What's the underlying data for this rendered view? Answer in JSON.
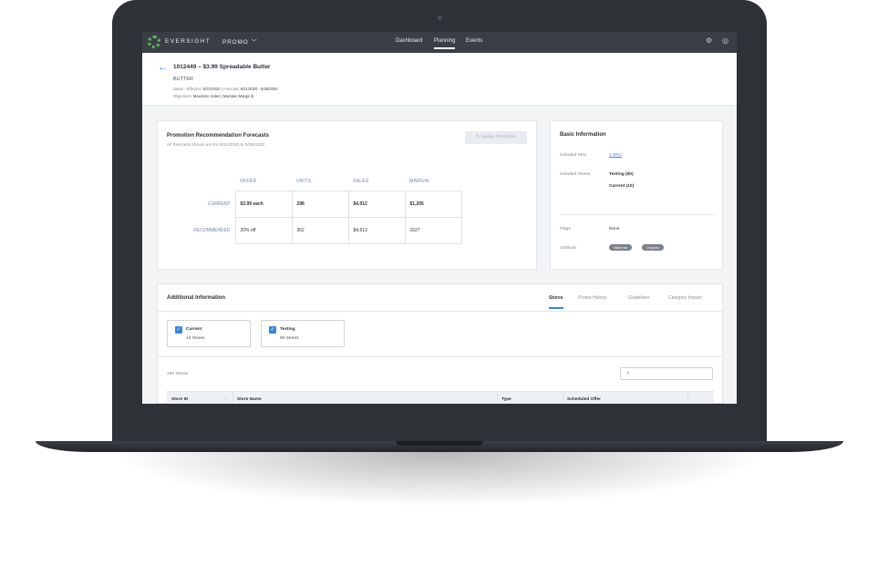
{
  "nav": {
    "brand": "EVERSIGHT",
    "promo_menu": "PROMO",
    "links": [
      "Dashboard",
      "Planning",
      "Events"
    ],
    "active_link": "Planning",
    "icons": [
      "gear-icon",
      "user-icon"
    ]
  },
  "header": {
    "title": "1012449 – $3.99 Spreadable Butter",
    "category": "BUTTER",
    "dates_label": "Dates - Effective:",
    "effective_date": "5/21/2020",
    "forecast_label": "Forecast:",
    "forecast_range": "5/21/2020 - 5/28/2020",
    "objectives_label": "Objectives:",
    "objectives": "Maximize Sales | Maintain Margin $"
  },
  "forecasts": {
    "title": "Promotion Recommendation Forecasts",
    "subtitle": "All forecasts shown are for 5/21/2020 to 5/28/2020",
    "update_button": "Update Promotion",
    "columns": [
      "OFFER",
      "UNITS",
      "SALES",
      "MARGIN"
    ],
    "rows": [
      {
        "label": "CURRENT",
        "values": [
          "$3.99 each",
          "298",
          "$4,012",
          "$1,205"
        ]
      },
      {
        "label": "RECOMMENDED",
        "values": [
          "20% off",
          "352",
          "$4,613",
          "1627"
        ]
      }
    ]
  },
  "basic_info": {
    "title": "Basic Information",
    "included_sku_label": "Included SKU",
    "included_sku_value": "1 SKU",
    "included_stores_label": "Included Stores",
    "stores_testing": "Testing (90)",
    "stores_current": "Current (10)",
    "flags_label": "Flags",
    "flags_value": "None",
    "attribute_label": "Attribute",
    "attributes": [
      "National",
      "Organic"
    ]
  },
  "additional": {
    "title": "Additional Information",
    "tabs": [
      "Stores",
      "Promo History",
      "Guidelines",
      "Category Impact"
    ],
    "active_tab": "Stores",
    "filters": [
      {
        "title": "Current",
        "sub": "10 Stores",
        "checked": true
      },
      {
        "title": "Testing",
        "sub": "90 Stores",
        "checked": true
      }
    ],
    "store_count": "100 Stores",
    "search_placeholder": "",
    "table_headers": [
      "Store ID",
      "Store Name",
      "Type",
      "Scheduled Offer"
    ]
  },
  "colors": {
    "accent": "#3a86d8",
    "nav_bg": "#3a3f47",
    "laptop_frame": "#2e3136"
  }
}
